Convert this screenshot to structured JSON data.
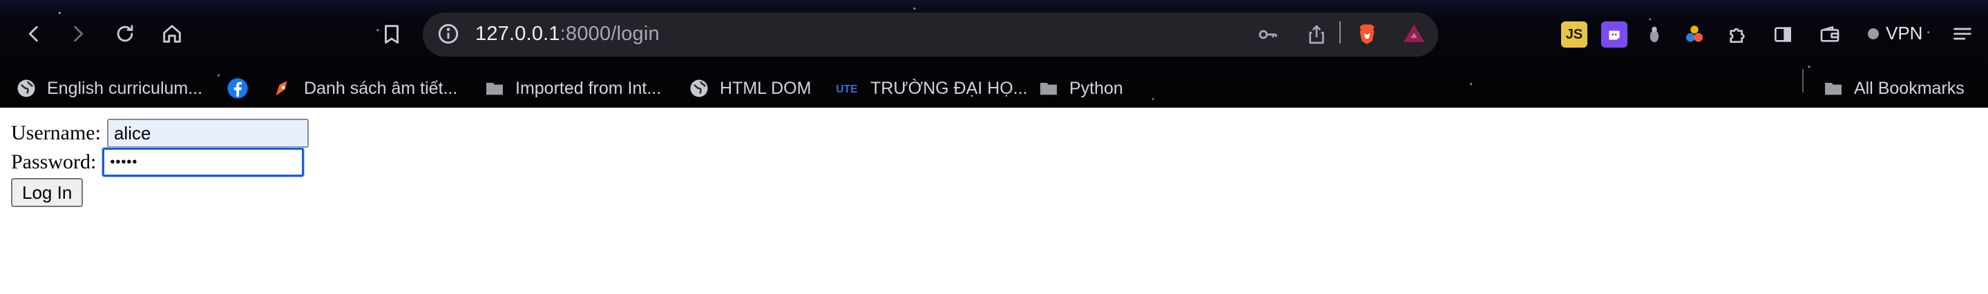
{
  "browser": {
    "address_bar": {
      "host": "127.0.0.1",
      "path": ":8000/login"
    },
    "toolbar_icons": {
      "back": "back-arrow-icon",
      "forward": "forward-arrow-icon",
      "reload": "reload-icon",
      "home": "home-icon",
      "bookmark": "bookmark-icon",
      "site_info": "info-icon",
      "password_key": "key-icon",
      "share": "share-icon",
      "brave_shields": "brave-lion-icon",
      "brave_rewards": "brave-rewards-triangle-icon"
    },
    "extensions": [
      {
        "name": "js-extension-icon",
        "text": "JS",
        "color": "#e8c547"
      },
      {
        "name": "purple-extension-icon",
        "text": "",
        "color": "#7a4cf0"
      },
      {
        "name": "bug-extension-icon",
        "text": "",
        "color": "#9a9da4"
      },
      {
        "name": "colorful-dots-extension-icon",
        "text": "",
        "color": "#2f7de1"
      },
      {
        "name": "puzzle-extensions-icon",
        "text": "",
        "color": "#c9ccd2"
      },
      {
        "name": "sidebar-icon",
        "text": "",
        "color": "#c9ccd2"
      },
      {
        "name": "wallet-icon",
        "text": "",
        "color": "#c9ccd2"
      }
    ],
    "vpn_label": "VPN",
    "menu_icon": "hamburger-menu-icon",
    "bookmarks": [
      {
        "label": "English curriculum...",
        "icon": "globe-icon"
      },
      {
        "label": "",
        "icon": "facebook-icon"
      },
      {
        "label": "Danh sách âm tiết...",
        "icon": "pen-tool-icon"
      },
      {
        "label": "Imported from Int...",
        "icon": "folder-icon"
      },
      {
        "label": "HTML DOM",
        "icon": "globe-icon"
      },
      {
        "label": "TRƯỜNG ĐẠI HỌ...",
        "icon": "ute-logo-icon"
      },
      {
        "label": "Python",
        "icon": "folder-icon"
      }
    ],
    "all_bookmarks_label": "All Bookmarks"
  },
  "login_form": {
    "username_label": "Username:",
    "username_value": "alice",
    "password_label": "Password:",
    "password_value": "•••••",
    "submit_label": "Log In"
  },
  "colors": {
    "focus_ring": "#1a5fd6",
    "autofill_bg": "#e8f0fe"
  }
}
